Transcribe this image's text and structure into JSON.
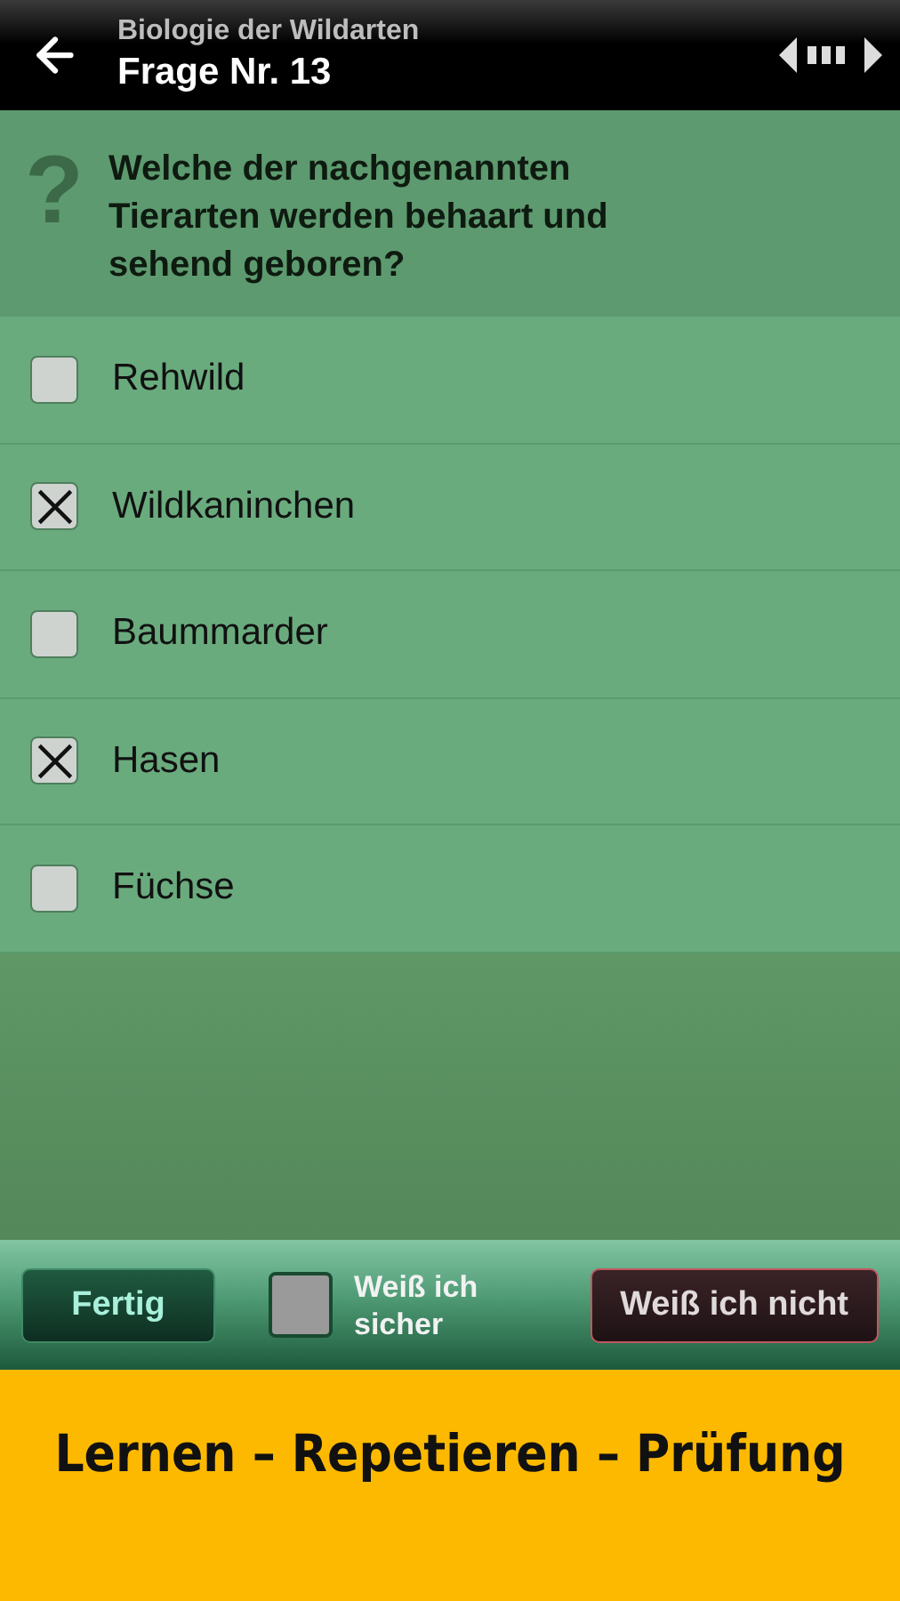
{
  "header": {
    "subtitle": "Biologie der Wildarten",
    "title": "Frage Nr. 13"
  },
  "question": {
    "mark": "?",
    "text": "Welche der nachgenannten Tierarten werden behaart und sehend geboren?"
  },
  "answers": [
    {
      "label": "Rehwild",
      "checked": false
    },
    {
      "label": "Wildkaninchen",
      "checked": true
    },
    {
      "label": "Baummarder",
      "checked": false
    },
    {
      "label": "Hasen",
      "checked": true
    },
    {
      "label": "Füchse",
      "checked": false
    }
  ],
  "bottom_bar": {
    "done_button": "Fertig",
    "sure": {
      "label": "Weiß ich sicher",
      "checked": false
    },
    "dont_know_button": "Weiß ich nicht"
  },
  "banner": "Lernen – Repetieren – Prüfung"
}
